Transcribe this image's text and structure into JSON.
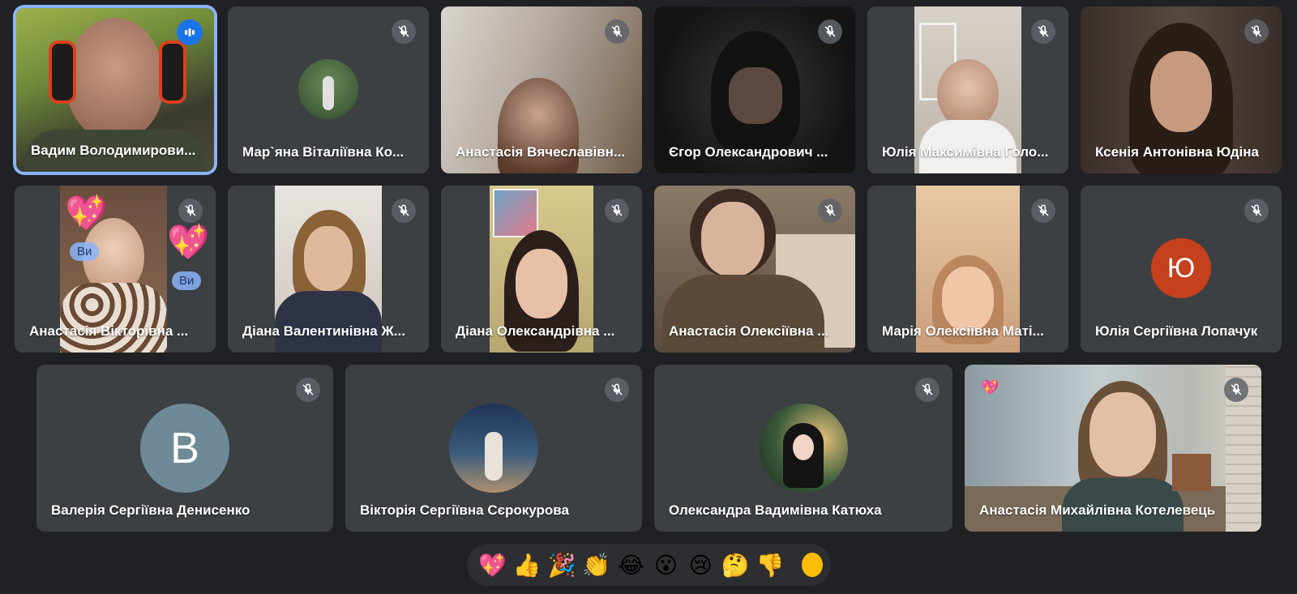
{
  "participants": [
    {
      "name": "Вадим Володимирови...",
      "status": "speaking"
    },
    {
      "name": "Мар`яна Віталіївна Ко...",
      "status": "muted"
    },
    {
      "name": "Анастасія Вячеславівн...",
      "status": "muted"
    },
    {
      "name": "Єгор Олександрович ...",
      "status": "muted"
    },
    {
      "name": "Юлія Максимівна Голо...",
      "status": "muted"
    },
    {
      "name": "Ксенія Антонівна Юдіна",
      "status": "muted"
    },
    {
      "name": "Анастасія Вікторівна ...",
      "status": "muted"
    },
    {
      "name": "Діана Валентинівна Ж...",
      "status": "muted"
    },
    {
      "name": "Діана Олександрівна ...",
      "status": "muted"
    },
    {
      "name": "Анастасія Олексіївна ...",
      "status": "muted"
    },
    {
      "name": "Марія Олексіївна Маті...",
      "status": "muted"
    },
    {
      "name": "Юлія Сергіївна Лопачук",
      "status": "muted",
      "avatar_letter": "Ю",
      "avatar_color": "#c5401c"
    },
    {
      "name": "Валерія Сергіївна Денисенко",
      "status": "muted",
      "avatar_letter": "В",
      "avatar_color": "#6d8a96"
    },
    {
      "name": "Вікторія Сергіївна Сєрокурова",
      "status": "muted"
    },
    {
      "name": "Олександра Вадимівна Катюха",
      "status": "muted"
    },
    {
      "name": "Анастасія Михайлівна Котелевець",
      "status": "muted"
    }
  ],
  "reaction_badge": "Ви",
  "reactions": [
    "💖",
    "👍",
    "🎉",
    "👏",
    "😂",
    "😮",
    "😢",
    "🤔",
    "👎"
  ],
  "colors": {
    "background": "#202124",
    "tile": "#3c4043",
    "speaking_outline": "#8ab4f8",
    "speaking_indicator": "#1a73e8",
    "skin_tone_dot": "#fbbc04"
  }
}
